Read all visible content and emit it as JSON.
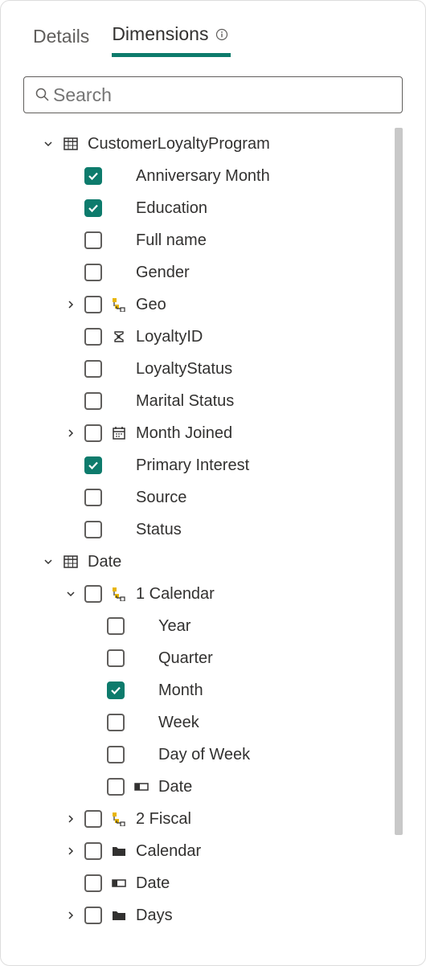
{
  "tabs": {
    "details": "Details",
    "dimensions": "Dimensions"
  },
  "search": {
    "placeholder": "Search"
  },
  "tree": {
    "customerLoyalty": {
      "label": "CustomerLoyaltyProgram",
      "anniversary": "Anniversary Month",
      "education": "Education",
      "fullname": "Full name",
      "gender": "Gender",
      "geo": "Geo",
      "loyaltyId": "LoyaltyID",
      "loyaltyStatus": "LoyaltyStatus",
      "maritalStatus": "Marital Status",
      "monthJoined": "Month Joined",
      "primaryInterest": "Primary Interest",
      "source": "Source",
      "status": "Status"
    },
    "date": {
      "label": "Date",
      "calendar1": {
        "label": "1 Calendar",
        "year": "Year",
        "quarter": "Quarter",
        "month": "Month",
        "week": "Week",
        "dayOfWeek": "Day of Week",
        "date": "Date"
      },
      "fiscal2": "2 Fiscal",
      "calendar": "Calendar",
      "dateLeaf": "Date",
      "days": "Days"
    }
  }
}
